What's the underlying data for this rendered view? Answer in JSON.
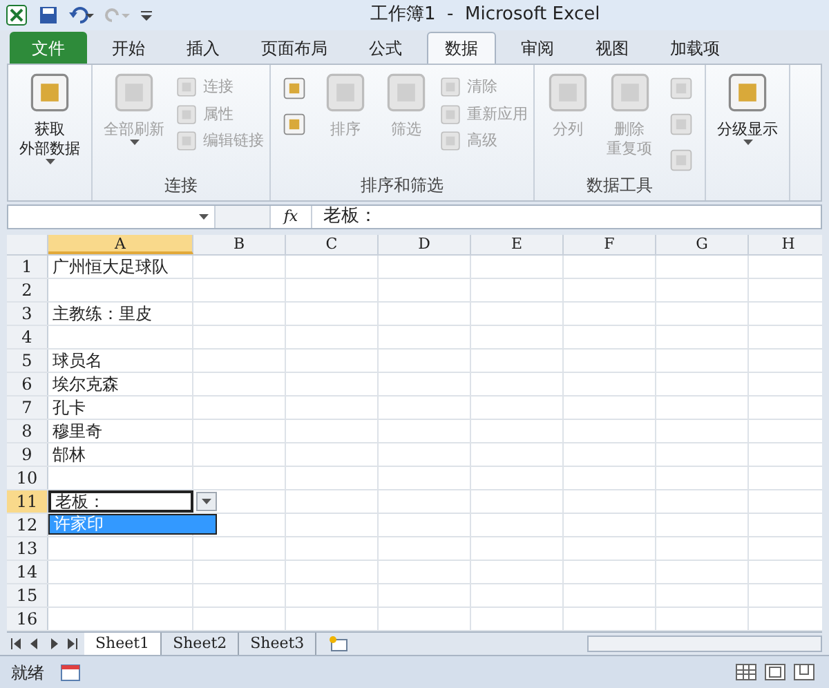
{
  "title_bar": {
    "title": "工作簿1  -  Microsoft Excel"
  },
  "tabs": [
    {
      "label": "文件",
      "kind": "file",
      "selected": false
    },
    {
      "label": "开始",
      "kind": "tab",
      "selected": false
    },
    {
      "label": "插入",
      "kind": "tab",
      "selected": false
    },
    {
      "label": "页面布局",
      "kind": "tab",
      "selected": false
    },
    {
      "label": "公式",
      "kind": "tab",
      "selected": false
    },
    {
      "label": "数据",
      "kind": "tab",
      "selected": true
    },
    {
      "label": "审阅",
      "kind": "tab",
      "selected": false
    },
    {
      "label": "视图",
      "kind": "tab",
      "selected": false
    },
    {
      "label": "加载项",
      "kind": "tab",
      "selected": false
    }
  ],
  "ribbon_groups": [
    {
      "items": [
        {
          "kind": "large",
          "lines": [
            "获取",
            "外部数据"
          ],
          "disabled": false,
          "caret": true
        }
      ]
    },
    {
      "name": "连接",
      "items": [
        {
          "kind": "large",
          "lines": [
            "全部刷新"
          ],
          "disabled": true,
          "caret": true
        },
        {
          "kind": "stack",
          "items": [
            {
              "label": "连接",
              "disabled": true
            },
            {
              "label": "属性",
              "disabled": true
            },
            {
              "label": "编辑链接",
              "disabled": true
            }
          ]
        }
      ]
    },
    {
      "name": "排序和筛选",
      "items": [
        {
          "kind": "iconstack",
          "icons": [
            {
              "disabled": false
            },
            {
              "disabled": false
            }
          ]
        },
        {
          "kind": "large",
          "lines": [
            "排序"
          ],
          "disabled": true,
          "caret": false
        },
        {
          "kind": "large",
          "lines": [
            "筛选"
          ],
          "disabled": true,
          "caret": false
        },
        {
          "kind": "stack",
          "items": [
            {
              "label": "清除",
              "disabled": true
            },
            {
              "label": "重新应用",
              "disabled": true
            },
            {
              "label": "高级",
              "disabled": true
            }
          ]
        }
      ]
    },
    {
      "name": "数据工具",
      "items": [
        {
          "kind": "large",
          "lines": [
            "分列"
          ],
          "disabled": true,
          "caret": false
        },
        {
          "kind": "large",
          "lines": [
            "删除",
            "重复项"
          ],
          "disabled": true,
          "caret": false
        },
        {
          "kind": "iconstack",
          "icons": [
            {
              "disabled": true
            },
            {
              "disabled": true
            },
            {
              "disabled": true
            }
          ]
        }
      ]
    },
    {
      "items": [
        {
          "kind": "large",
          "lines": [
            "分级显示"
          ],
          "disabled": false,
          "caret": true
        }
      ]
    }
  ],
  "formula_bar": {
    "fx_label": "fx",
    "formula": "老板："
  },
  "columns": [
    {
      "label": "A",
      "selected": true
    },
    {
      "label": "B",
      "selected": false
    },
    {
      "label": "C",
      "selected": false
    },
    {
      "label": "D",
      "selected": false
    },
    {
      "label": "E",
      "selected": false
    },
    {
      "label": "F",
      "selected": false
    },
    {
      "label": "G",
      "selected": false
    },
    {
      "label": "H",
      "selected": false
    }
  ],
  "rows": [
    {
      "number": "1",
      "selected": false,
      "a": "广州恒大足球队"
    },
    {
      "number": "2",
      "selected": false
    },
    {
      "number": "3",
      "selected": false,
      "a": "主教练：里皮"
    },
    {
      "number": "4",
      "selected": false
    },
    {
      "number": "5",
      "selected": false,
      "a": "球员名"
    },
    {
      "number": "6",
      "selected": false,
      "a": "埃尔克森"
    },
    {
      "number": "7",
      "selected": false,
      "a": "孔卡"
    },
    {
      "number": "8",
      "selected": false,
      "a": "穆里奇"
    },
    {
      "number": "9",
      "selected": false,
      "a": "郜林"
    },
    {
      "number": "10",
      "selected": false
    },
    {
      "number": "11",
      "selected": true,
      "a": "老板：",
      "dropdown": [
        {
          "label": "许家印",
          "selected": true
        }
      ]
    },
    {
      "number": "12",
      "selected": false
    },
    {
      "number": "13",
      "selected": false
    },
    {
      "number": "14",
      "selected": false
    },
    {
      "number": "15",
      "selected": false
    },
    {
      "number": "16",
      "selected": false
    }
  ],
  "sheet_tabs": [
    {
      "label": "Sheet1",
      "selected": true
    },
    {
      "label": "Sheet2",
      "selected": false
    },
    {
      "label": "Sheet3",
      "selected": false
    }
  ],
  "status_bar": {
    "text": "就绪"
  }
}
